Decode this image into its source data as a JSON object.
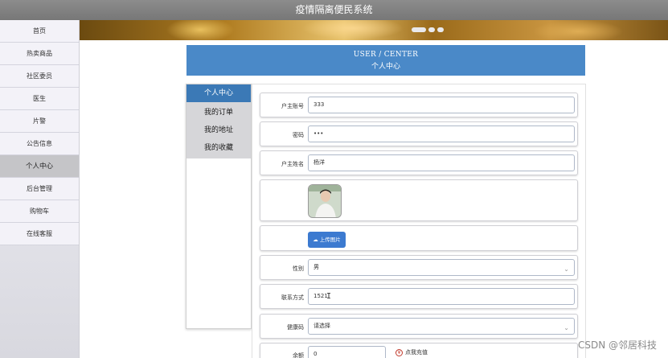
{
  "app": {
    "title": "疫情隔离便民系统"
  },
  "sidebar": {
    "items": [
      {
        "label": "首页"
      },
      {
        "label": "热卖商品"
      },
      {
        "label": "社区委员"
      },
      {
        "label": "医生"
      },
      {
        "label": "片警"
      },
      {
        "label": "公告信息"
      },
      {
        "label": "个人中心",
        "active": true
      },
      {
        "label": "后台管理"
      },
      {
        "label": "购物车"
      },
      {
        "label": "在线客服"
      }
    ]
  },
  "user_center": {
    "title_en": "USER / CENTER",
    "title_cn": "个人中心"
  },
  "tabs": [
    {
      "label": "个人中心",
      "active": true
    },
    {
      "label": "我的订单"
    },
    {
      "label": "我的地址"
    },
    {
      "label": "我的收藏"
    }
  ],
  "form": {
    "account": {
      "label": "户主账号",
      "value": "333"
    },
    "password": {
      "label": "密码",
      "value": "•••"
    },
    "name": {
      "label": "户主姓名",
      "value": "杨洋"
    },
    "upload": {
      "label": "上传图片"
    },
    "gender": {
      "label": "性别",
      "value": "男"
    },
    "phone": {
      "label": "联系方式",
      "value": "1521"
    },
    "health_code": {
      "label": "健康码",
      "value": "请选择"
    },
    "balance": {
      "label": "余额",
      "value": "0",
      "recharge_label": "点我充值"
    }
  },
  "watermark": "CSDN @邻居科技",
  "colors": {
    "header_blue": "#4a89c8",
    "tab_active": "#3b79b6",
    "upload_button": "#3c7ad0"
  }
}
